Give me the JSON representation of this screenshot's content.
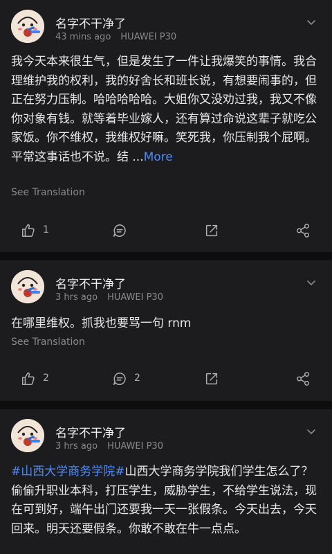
{
  "posts": [
    {
      "username": "名字不干净了",
      "time": "43 mins ago",
      "device": "HUAWEI P30",
      "text": "我今天本来很生气，但是发生了一件让我爆笑的事情。我合理维护我的权利，我的好舍长和班长说，有想要闹事的，但正在努力压制。哈哈哈哈哈。大姐你又没劝过我，我又不像你对象有钱。就等着毕业嫁人，还有算过命说这辈子就吃公家饭。你不维权，我维权好嘛。笑死我，你压制我个屁啊。平常这事话也不说。结 ...",
      "more": "More",
      "translate": "See Translation",
      "likes": "1",
      "comments": ""
    },
    {
      "username": "名字不干净了",
      "time": "3 hrs ago",
      "device": "HUAWEI P30",
      "text": "在哪里维权。抓我也要骂一句 rnm",
      "translate": "See Translation",
      "likes": "2",
      "comments": "2"
    },
    {
      "username": "名字不干净了",
      "time": "3 hrs ago",
      "device": "HUAWEI P30",
      "hashtag": "#山西大学商务学院#",
      "text": "山西大学商务学院我们学生怎么了？偷偷升职业本科，打压学生，威胁学生，不给学生说法，现在可到好，端午出门还要我一天一张假条。今天出去，今天回来。明天还要假条。你敢不敢在牛一点点。"
    }
  ],
  "colors": {
    "background": "#0d0d0d",
    "card": "#1c1c1e",
    "link": "#4a8cff",
    "muted": "#8a8a8e"
  }
}
